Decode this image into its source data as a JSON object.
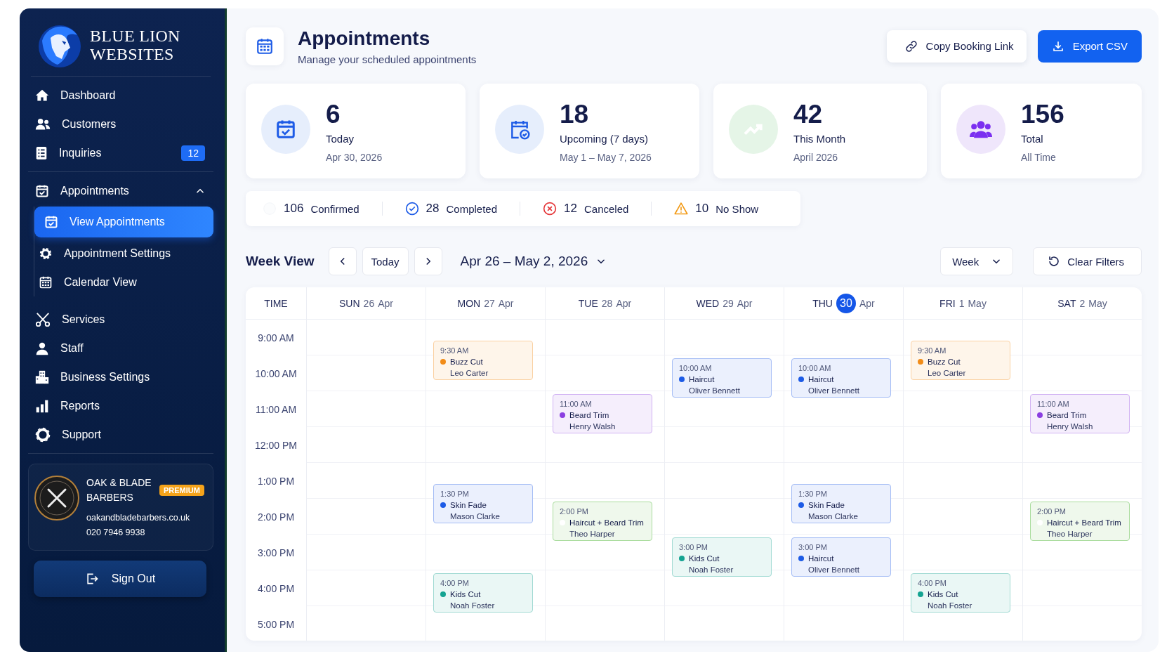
{
  "sidebar": {
    "logo": {
      "line1": "BLUE LION",
      "line2": "WEBSITES"
    },
    "sections": [
      {
        "items": [
          {
            "label": "Dashboard",
            "selected": false
          },
          {
            "label": "Customers",
            "selected": false
          },
          {
            "label": "Inquiries",
            "selected": false,
            "badge": "12"
          }
        ]
      },
      {
        "items": [
          {
            "label": "Appointments",
            "selected": false,
            "expanded": true,
            "children": [
              {
                "label": "View Appointments",
                "selected": true
              },
              {
                "label": "Appointment Settings",
                "selected": false
              },
              {
                "label": "Calendar View",
                "selected": false
              }
            ]
          }
        ]
      },
      {
        "items": [
          {
            "label": "Services",
            "selected": false
          },
          {
            "label": "Staff",
            "selected": false
          },
          {
            "label": "Business Settings",
            "selected": false
          },
          {
            "label": "Reports",
            "selected": false
          },
          {
            "label": "Support",
            "selected": false
          }
        ]
      }
    ],
    "business": {
      "name": "OAK & BLADE BARBERS",
      "plan": "PREMIUM",
      "website": "oakandbladebarbers.co.uk",
      "phone": "020 7946 9938"
    },
    "sign_out": "Sign Out"
  },
  "header": {
    "title": "Appointments",
    "subtitle": "Manage your scheduled appointments",
    "buttons": [
      {
        "label": "Copy Booking Link",
        "kind": "secondary"
      },
      {
        "label": "Export CSV",
        "kind": "primary"
      }
    ]
  },
  "stats": [
    {
      "value": "6",
      "label": "Today",
      "sub": "Apr 30, 2026"
    },
    {
      "value": "18",
      "label": "Upcoming (7 days)",
      "sub": "May 1 – May 7, 2026"
    },
    {
      "value": "42",
      "label": "This Month",
      "sub": "April 2026"
    },
    {
      "value": "156",
      "label": "Total",
      "sub": "All Time"
    }
  ],
  "status_counts": [
    {
      "count": "106",
      "label": "Confirmed"
    },
    {
      "count": "28",
      "label": "Completed"
    },
    {
      "count": "12",
      "label": "Canceled"
    },
    {
      "count": "10",
      "label": "No Show"
    }
  ],
  "toolbar": {
    "title": "Week View",
    "today_button": "Today",
    "range": "Apr 26 – May 2, 2026",
    "view_select": "Week",
    "clear_button": "Clear Filters"
  },
  "calendar": {
    "time_heading": "TIME",
    "times": [
      "9:00 AM",
      "10:00 AM",
      "11:00 AM",
      "12:00 PM",
      "1:00 PM",
      "2:00 PM",
      "3:00 PM",
      "4:00 PM",
      "5:00 PM"
    ],
    "days": [
      {
        "weekday": "SUN",
        "date": "26",
        "month": "Apr",
        "selected": false
      },
      {
        "weekday": "MON",
        "date": "27",
        "month": "Apr",
        "selected": false,
        "events": [
          {
            "time": "9:30 AM",
            "service": "Buzz Cut",
            "client": "Leo Carter",
            "kind": "single",
            "color": "#f28c18"
          },
          {
            "time": "1:30 PM",
            "service": "Skin Fade",
            "client": "Mason Clarke",
            "kind": "single",
            "color": "#1d5be6"
          },
          {
            "time": "4:00 PM",
            "service": "Kids Cut",
            "client": "Noah Foster",
            "kind": "single",
            "color": "#14a391"
          }
        ]
      },
      {
        "weekday": "TUE",
        "date": "28",
        "month": "Apr",
        "selected": false,
        "events": [
          {
            "time": "11:00 AM",
            "service": "Beard Trim",
            "client": "Henry Walsh",
            "kind": "single",
            "color": "#8b3fe0"
          },
          {
            "time": "2:00 PM",
            "service": "Haircut + Beard Trim",
            "client": "Theo Harper",
            "kind": "combo",
            "color": "#ffffff"
          }
        ]
      },
      {
        "weekday": "WED",
        "date": "29",
        "month": "Apr",
        "selected": false,
        "events": [
          {
            "time": "10:00 AM",
            "service": "Haircut",
            "client": "Oliver Bennett",
            "kind": "single",
            "color": "#1d5be6"
          },
          {
            "time": "3:00 PM",
            "service": "Kids Cut",
            "client": "Noah Foster",
            "kind": "single",
            "color": "#14a391"
          }
        ]
      },
      {
        "weekday": "THU",
        "date": "30",
        "month": "Apr",
        "selected": true,
        "events": [
          {
            "time": "10:00 AM",
            "service": "Haircut",
            "client": "Oliver Bennett",
            "kind": "single",
            "color": "#1d5be6"
          },
          {
            "time": "1:30 PM",
            "service": "Skin Fade",
            "client": "Mason Clarke",
            "kind": "single",
            "color": "#1d5be6"
          },
          {
            "time": "3:00 PM",
            "service": "Haircut",
            "client": "Oliver Bennett",
            "kind": "single",
            "color": "#1d5be6"
          }
        ]
      },
      {
        "weekday": "FRI",
        "date": "1",
        "month": "May",
        "selected": false,
        "events": [
          {
            "time": "9:30 AM",
            "service": "Buzz Cut",
            "client": "Leo Carter",
            "kind": "single",
            "color": "#f28c18"
          },
          {
            "time": "4:00 PM",
            "service": "Kids Cut",
            "client": "Noah Foster",
            "kind": "single",
            "color": "#14a391"
          }
        ]
      },
      {
        "weekday": "SAT",
        "date": "2",
        "month": "May",
        "selected": false,
        "events": [
          {
            "time": "11:00 AM",
            "service": "Beard Trim",
            "client": "Henry Walsh",
            "kind": "single",
            "color": "#8b3fe0"
          },
          {
            "time": "2:00 PM",
            "service": "Haircut + Beard Trim",
            "client": "Theo Harper",
            "kind": "combo",
            "color": "#ffffff"
          }
        ]
      }
    ]
  }
}
